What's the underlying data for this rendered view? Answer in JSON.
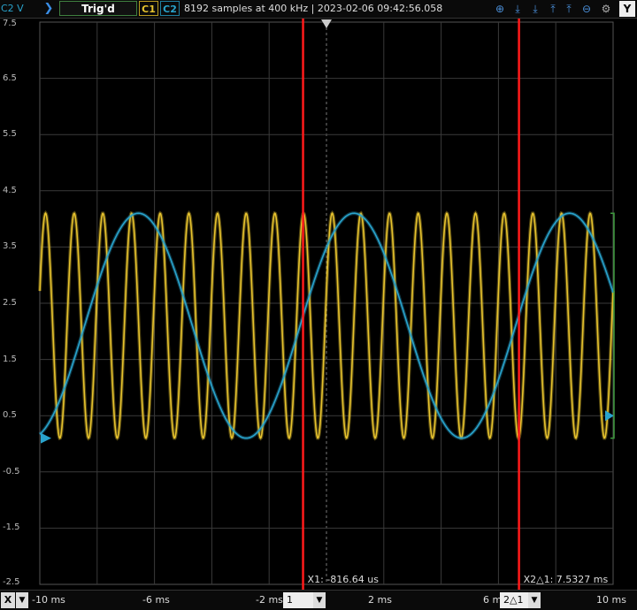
{
  "topbar": {
    "channel_scale": "C2 V",
    "trigger_status": "Trig'd",
    "c1_label": "C1",
    "c2_label": "C2",
    "acquisition_info": "8192 samples at 400 kHz | 2023-02-06 09:42:56.058",
    "y_button": "Y",
    "icons": [
      "zoom-in-icon",
      "align-down-icon",
      "align-down-alt-icon",
      "align-up-icon",
      "align-up-alt-icon",
      "zoom-out-icon",
      "settings-icon"
    ]
  },
  "bottombar": {
    "x_button": "X",
    "xticks": [
      "-10 ms",
      "-6 ms",
      "-2 ms",
      "2 ms",
      "6 ms",
      "10 ms"
    ],
    "cursor1_select": "1",
    "cursor2_select": "2△1"
  },
  "cursors": {
    "x1_label": "X1: -816.64 us",
    "x2_label": "X2△1: 7.5327 ms",
    "x1_ms": -0.81664,
    "x2_delta_ms": 7.5327
  },
  "colors": {
    "c1": "#e6c22e",
    "c2": "#29a3cc",
    "cursor": "#ff1a1a",
    "grid": "#3a3a3a"
  },
  "chart_data": {
    "type": "line",
    "xlim": [
      -10,
      10
    ],
    "ylim": [
      -2.5,
      7.5
    ],
    "x_unit": "ms",
    "y_unit": "V",
    "yticks": [
      "7.5",
      "6.5",
      "5.5",
      "4.5",
      "3.5",
      "2.5",
      "1.5",
      "0.5",
      "-0.5",
      "-1.5",
      "-2.5"
    ],
    "grid": true,
    "series": [
      {
        "name": "C1",
        "kind": "sine",
        "frequency_hz": 1000,
        "amplitude_v": 2.0,
        "offset_v": 2.1,
        "peak_time_ms": -0.8
      },
      {
        "name": "C2",
        "kind": "sine",
        "frequency_hz": 133,
        "amplitude_v": 2.0,
        "offset_v": 2.1,
        "peak_time_ms": 0.96
      }
    ]
  }
}
